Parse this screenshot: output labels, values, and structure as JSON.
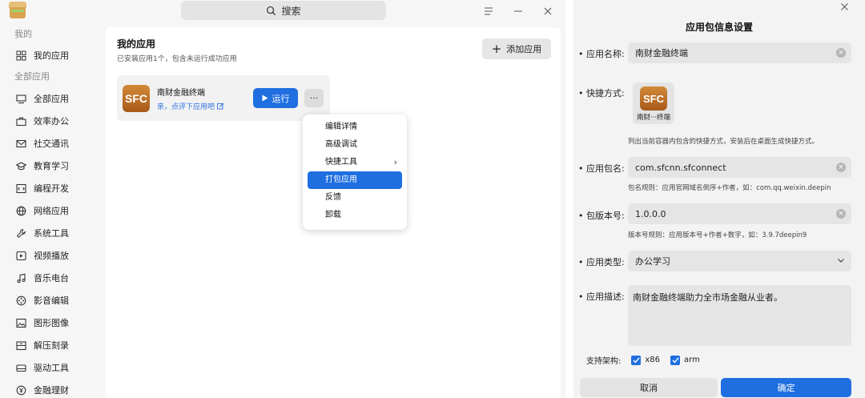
{
  "titlebar": {
    "search_label": "搜索",
    "menu_icon": "menu-icon",
    "minimize_icon": "minimize-icon",
    "close_icon": "close-icon"
  },
  "sidebar": {
    "group_mine": "我的",
    "item_my_apps": "我的应用",
    "group_all": "全部应用",
    "categories": [
      "全部应用",
      "效率办公",
      "社交通讯",
      "教育学习",
      "编程开发",
      "网络应用",
      "系统工具",
      "视频播放",
      "音乐电台",
      "影音编辑",
      "图形图像",
      "解压刻录",
      "驱动工具",
      "金融理财"
    ]
  },
  "main": {
    "title": "我的应用",
    "subtitle": "已安装应用1个，包含未运行成功应用",
    "add_button": "添加应用",
    "card": {
      "logo_text": "SFC",
      "name": "南财金融终端",
      "rate_link": "亲，点评下应用吧",
      "run_button": "运行",
      "more_button": "···"
    },
    "context_menu": [
      "编辑详情",
      "高级调试",
      "快捷工具",
      "打包应用",
      "反馈",
      "卸载"
    ]
  },
  "dialog": {
    "title": "应用包信息设置",
    "name_label": "• 应用名称:",
    "name_value": "南财金融终端",
    "shortcut_label": "• 快捷方式:",
    "shortcut_logo": "SFC",
    "shortcut_name": "南财···终端",
    "shortcut_hint": "列出当前容器内包含的快捷方式，安装后在桌面生成快捷方式。",
    "package_label": "• 应用包名:",
    "package_value": "com.sfcnn.sfconnect",
    "package_hint": "包名规则：应用官网域名倒序+作者，如：com.qq.weixin.deepin",
    "version_label": "• 包版本号:",
    "version_value": "1.0.0.0",
    "version_hint": "版本号规则：应用版本号+作者+数字，如：3.9.7deepin9",
    "type_label": "• 应用类型:",
    "type_value": "办公学习",
    "desc_label": "• 应用描述:",
    "desc_value": "南财金融终端助力全市场金融从业者。",
    "arch_label": "支持架构:",
    "arch_options": [
      "x86",
      "arm"
    ],
    "cancel_button": "取消",
    "ok_button": "确定"
  },
  "colors": {
    "accent": "#1f6fe0",
    "logo_orange": "#c07a2e"
  }
}
